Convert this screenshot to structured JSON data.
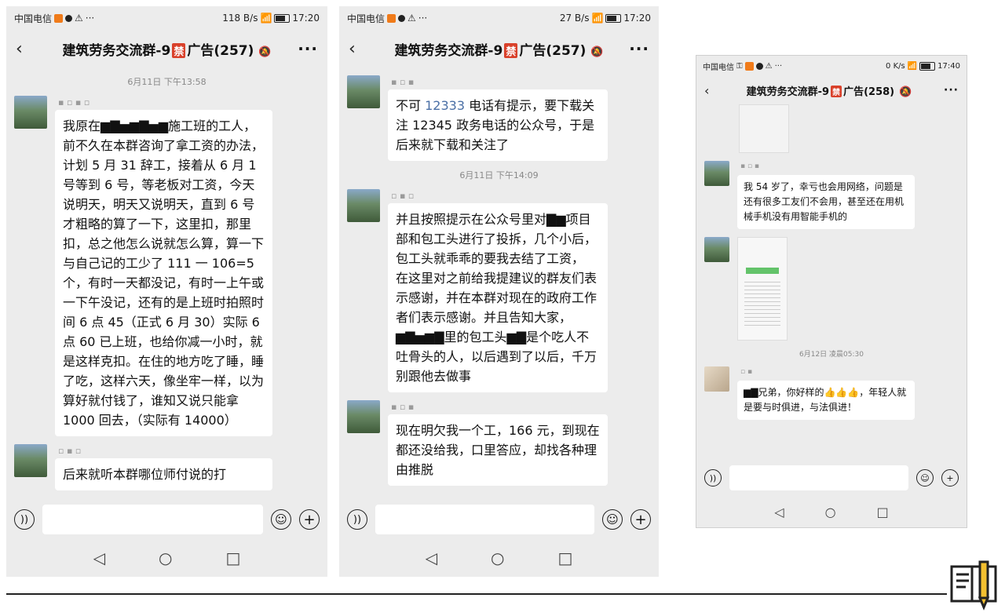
{
  "phones": [
    {
      "status": {
        "carrier": "中国电信",
        "speed": "118 B/s",
        "time": "17:20"
      },
      "title": "建筑劳务交流群-9",
      "ban": "禁",
      "title_suffix": "广告(257)",
      "messages": [
        {
          "type": "time",
          "text": "6月11日 下午13:58"
        },
        {
          "type": "text",
          "parts": [
            "我原在",
            "施工班的工人，前不久在本群咨询了拿工资的办法，计划 5 月 31 辞工，接着从 6 月 1 号等到 6 号，等老板对工资，今天说明天，明天又说明天，直到 6 号才粗略的算了一下，这里扣，那里扣，总之他怎么说就怎么算，算一下与自己记的工少了 111 一 106=5 个，有时一天都没记，有时一上午或一下午没记，还有的是上班时拍照时间 6 点 45（正式 6 月 30）实际 6 点 60 已上班，也给你减一小时，就是这样克扣。在住的地方吃了睡，睡了吃，这样六天，像坐牢一样，以为算好就付钱了，谁知又说只能拿 1000 回去，（实际有 14000）"
          ]
        },
        {
          "type": "text",
          "parts": [
            "后来就听本群哪位师付说的打"
          ]
        }
      ]
    },
    {
      "status": {
        "carrier": "中国电信",
        "speed": "27 B/s",
        "time": "17:20"
      },
      "title": "建筑劳务交流群-9",
      "ban": "禁",
      "title_suffix": "广告(257)",
      "messages": [
        {
          "type": "text",
          "parts": [
            "不可 ",
            "12333",
            " 电话有提示，要下载关注 12345 政务电话的公众号，于是后来就下载和关注了"
          ]
        },
        {
          "type": "time",
          "text": "6月11日 下午14:09"
        },
        {
          "type": "text",
          "parts": [
            "并且按照提示在公众号里对",
            "项目部和包工头进行了投拆，几个小后，包工头就乖乖的要我去结了工资，\n在这里对之前给我提建议的群友们表示感谢，并在本群对现在的政府工作者们表示感谢。并且告知大家，",
            "里的包工头",
            "是个吃人不吐骨头的人，以后遇到了以后，千万别跟他去做事"
          ]
        },
        {
          "type": "text",
          "parts": [
            "现在明欠我一个工，166 元，到现在都还没给我，口里答应，却找各种理由推脱"
          ]
        }
      ]
    },
    {
      "status": {
        "carrier": "中国电信",
        "speed": "0 K/s",
        "time": "17:40"
      },
      "title": "建筑劳务交流群-9",
      "ban": "禁",
      "title_suffix": "广告(258)",
      "messages": [
        {
          "type": "text",
          "parts": [
            "我 54 岁了，幸亏也会用网络，问题是还有很多工友们不会用，甚至还在用机械手机没有用智能手机的"
          ]
        },
        {
          "type": "time",
          "text": "6月12日 凌晨05:30"
        },
        {
          "type": "text",
          "parts": [
            "兄弟，你好样的👍👍👍，年轻人就是要与时俱进，与法俱进！"
          ]
        }
      ]
    }
  ],
  "icons": {
    "back": "back-icon",
    "more": "more-icon",
    "voice": "voice-icon",
    "emoji": "emoji-icon",
    "plus": "plus-icon"
  }
}
